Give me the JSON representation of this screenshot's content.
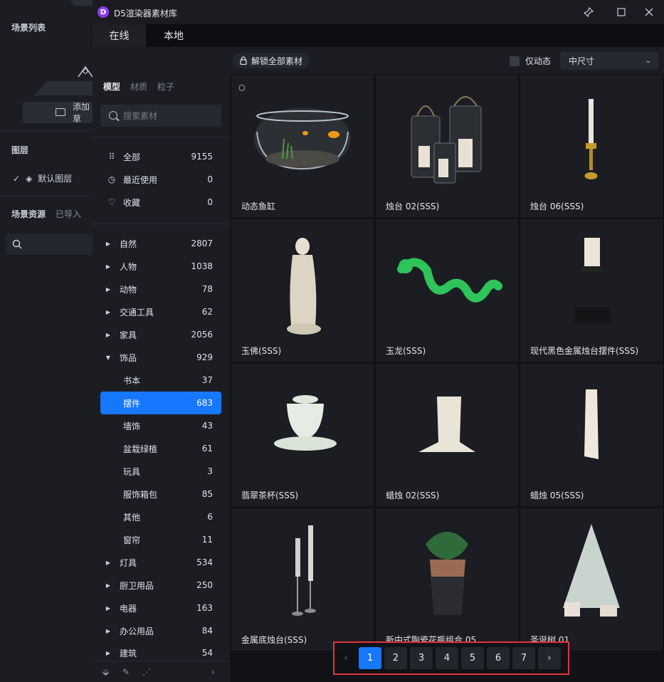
{
  "window": {
    "title": "D5渲染器素材库",
    "logo_letter": "D"
  },
  "host": {
    "scene_list_title": "场景列表",
    "add_label": "添加草",
    "layers_title": "图层",
    "default_layer": "默认图层",
    "tabs": [
      "场景资源",
      "已导入"
    ]
  },
  "top_tabs": [
    "在线",
    "本地"
  ],
  "sub_tabs": [
    "模型",
    "材质",
    "粒子"
  ],
  "search": {
    "placeholder": "搜索素材"
  },
  "quick": [
    {
      "label": "全部",
      "count": "9155",
      "icon": "grid-icon"
    },
    {
      "label": "最近使用",
      "count": "0",
      "icon": "history-icon"
    },
    {
      "label": "收藏",
      "count": "0",
      "icon": "heart-icon"
    }
  ],
  "categories": [
    {
      "label": "自然",
      "count": "2807"
    },
    {
      "label": "人物",
      "count": "1038"
    },
    {
      "label": "动物",
      "count": "78"
    },
    {
      "label": "交通工具",
      "count": "62"
    },
    {
      "label": "家具",
      "count": "2056"
    },
    {
      "label": "饰品",
      "count": "929"
    },
    {
      "label": "书本",
      "count": "37"
    },
    {
      "label": "摆件",
      "count": "683"
    },
    {
      "label": "墙饰",
      "count": "43"
    },
    {
      "label": "盆栽绿植",
      "count": "61"
    },
    {
      "label": "玩具",
      "count": "3"
    },
    {
      "label": "服饰箱包",
      "count": "85"
    },
    {
      "label": "其他",
      "count": "6"
    },
    {
      "label": "窗帘",
      "count": "11"
    },
    {
      "label": "灯具",
      "count": "534"
    },
    {
      "label": "厨卫用品",
      "count": "250"
    },
    {
      "label": "电器",
      "count": "163"
    },
    {
      "label": "办公用品",
      "count": "84"
    },
    {
      "label": "建筑",
      "count": "54"
    }
  ],
  "toolbar": {
    "unlock_label": "解锁全部素材",
    "dynamic_only": "仅动态",
    "size_value": "中尺寸"
  },
  "assets": [
    "动态鱼缸",
    "烛台 02(SSS)",
    "烛台 06(SSS)",
    "玉佛(SSS)",
    "玉龙(SSS)",
    "现代黑色金属烛台摆件(SSS)",
    "翡翠茶杯(SSS)",
    "蜡烛 02(SSS)",
    "蜡烛 05(SSS)",
    "金属底烛台(SSS)",
    "新中式陶瓷花瓶组合 05",
    "圣诞树 01"
  ],
  "pagination": {
    "pages": [
      "1",
      "2",
      "3",
      "4",
      "5",
      "6",
      "7"
    ],
    "current": "1",
    "prev": "‹",
    "next": "›"
  },
  "colors": {
    "accent": "#1677ff",
    "highlight_border": "#e0343a",
    "logo": "#8b3cf7"
  }
}
